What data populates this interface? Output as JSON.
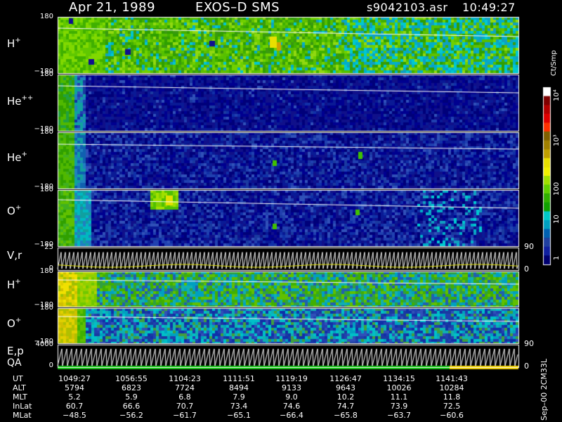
{
  "header": {
    "date": "Apr 21, 1989",
    "mission": "EXOS–D SMS",
    "file": "s9042103.asr",
    "time": "10:49:27"
  },
  "colorbar": {
    "unit": "Ct/Smp",
    "labels": [
      "10⁴",
      "10³",
      "100",
      "10",
      "1"
    ],
    "colors": [
      "#ffffff",
      "#7f0000",
      "#b40000",
      "#e00000",
      "#ff3000",
      "#806000",
      "#a08000",
      "#c0a000",
      "#e8e000",
      "#f0f000",
      "#9fe000",
      "#60d000",
      "#30b000",
      "#10a000",
      "#00c8c8",
      "#00a0c0",
      "#0060b0",
      "#2040a0",
      "#1020a0",
      "#000070"
    ]
  },
  "panels": [
    {
      "id": "H+1",
      "ion": "H",
      "charge": "+",
      "ymax": "180",
      "ymin": "−180"
    },
    {
      "id": "He++",
      "ion": "He",
      "charge": "++",
      "ymax": "180",
      "ymin": "−180"
    },
    {
      "id": "He+",
      "ion": "He",
      "charge": "+",
      "ymax": "180",
      "ymin": "−180"
    },
    {
      "id": "O+1",
      "ion": "O",
      "charge": "+",
      "ymax": "180",
      "ymin": "−180"
    },
    {
      "id": "V,r",
      "label": "V,r",
      "ymax": "25",
      "ymin": "0",
      "rmax": "90",
      "rmin": "0"
    },
    {
      "id": "H+2",
      "ion": "H",
      "charge": "+",
      "ymax": "180",
      "ymin": "−180"
    },
    {
      "id": "O+2",
      "ion": "O",
      "charge": "+",
      "ymax": "180",
      "ymin": "−180"
    },
    {
      "id": "E,p",
      "label": "E,p",
      "label2": "QA",
      "ymax": "4000",
      "ymin": "0",
      "rmax": "90",
      "rmin": "0"
    }
  ],
  "table": {
    "labels": [
      "UT",
      "ALT",
      "MLT",
      "InLat",
      "MLat"
    ],
    "columns": [
      [
        "1049:27",
        "5794",
        "5.2",
        "60.7",
        "−48.5"
      ],
      [
        "1056:55",
        "6823",
        "5.9",
        "66.6",
        "−56.2"
      ],
      [
        "1104:23",
        "7724",
        "6.8",
        "70.7",
        "−61.7"
      ],
      [
        "1111:51",
        "8494",
        "7.9",
        "73.4",
        "−65.1"
      ],
      [
        "1119:19",
        "9133",
        "9.0",
        "74.6",
        "−66.4"
      ],
      [
        "1126:47",
        "9643",
        "10.2",
        "74.7",
        "−65.8"
      ],
      [
        "1134:15",
        "10026",
        "11.1",
        "73.9",
        "−63.7"
      ],
      [
        "1141:43",
        "10284",
        "11.8",
        "72.5",
        "−60.6"
      ]
    ],
    "footer": "Sep–00 2CM33L"
  },
  "chart_data": {
    "type": "heatmap",
    "x_axis": "UT",
    "x_ticks": [
      "1049:27",
      "1056:55",
      "1104:23",
      "1111:51",
      "1119:19",
      "1126:47",
      "1134:15",
      "1141:43"
    ],
    "panels": [
      "H+",
      "He++",
      "He+",
      "O+",
      "V,r",
      "H+",
      "O+",
      "E,p"
    ],
    "pitch_angle_range": [
      -180,
      180
    ],
    "colorscale": "log",
    "color_range": [
      1,
      10000
    ],
    "colorbar_unit": "Ct/Smp"
  }
}
